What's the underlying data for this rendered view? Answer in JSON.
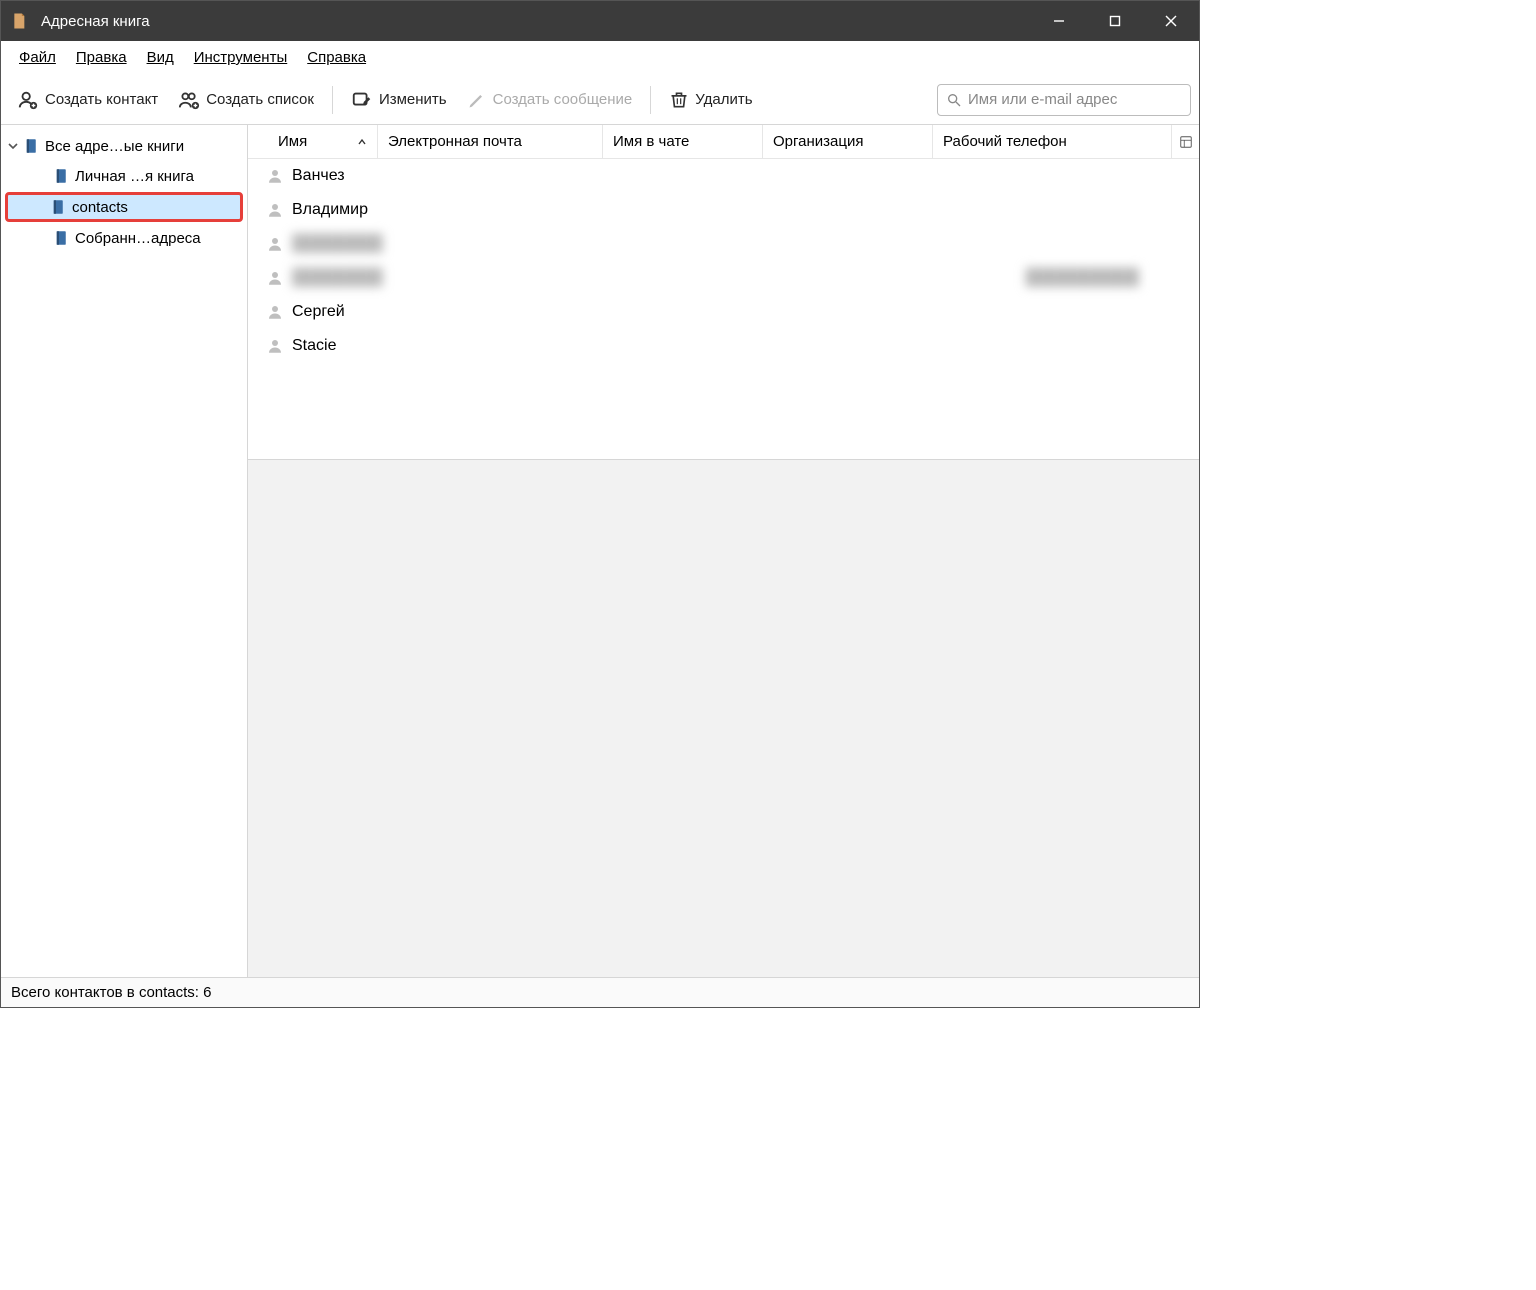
{
  "window": {
    "title": "Адресная книга"
  },
  "menubar": {
    "file": "Файл",
    "edit": "Правка",
    "view": "Вид",
    "tools": "Инструменты",
    "help": "Справка"
  },
  "toolbar": {
    "new_contact": "Создать контакт",
    "new_list": "Создать список",
    "edit": "Изменить",
    "compose": "Создать сообщение",
    "delete": "Удалить",
    "search_placeholder": "Имя или e-mail адрес"
  },
  "sidebar": {
    "root": "Все адре…ые книги",
    "items": [
      "Личная …я книга",
      "contacts",
      "Собранн…адреса"
    ],
    "selected_index": 1
  },
  "columns": {
    "name": "Имя",
    "email": "Электронная почта",
    "chat_name": "Имя в чате",
    "organization": "Организация",
    "work_phone": "Рабочий телефон"
  },
  "contacts": [
    {
      "name": "Ванчез",
      "blurred": false,
      "phone": ""
    },
    {
      "name": "Владимир",
      "blurred": false,
      "phone": ""
    },
    {
      "name": "hidden",
      "blurred": true,
      "phone": ""
    },
    {
      "name": "hidden",
      "blurred": true,
      "phone": "xxxxxxxxx"
    },
    {
      "name": "Сергей",
      "blurred": false,
      "phone": ""
    },
    {
      "name": "Stacie",
      "blurred": false,
      "phone": ""
    }
  ],
  "statusbar": {
    "text": "Всего контактов в contacts: 6"
  }
}
